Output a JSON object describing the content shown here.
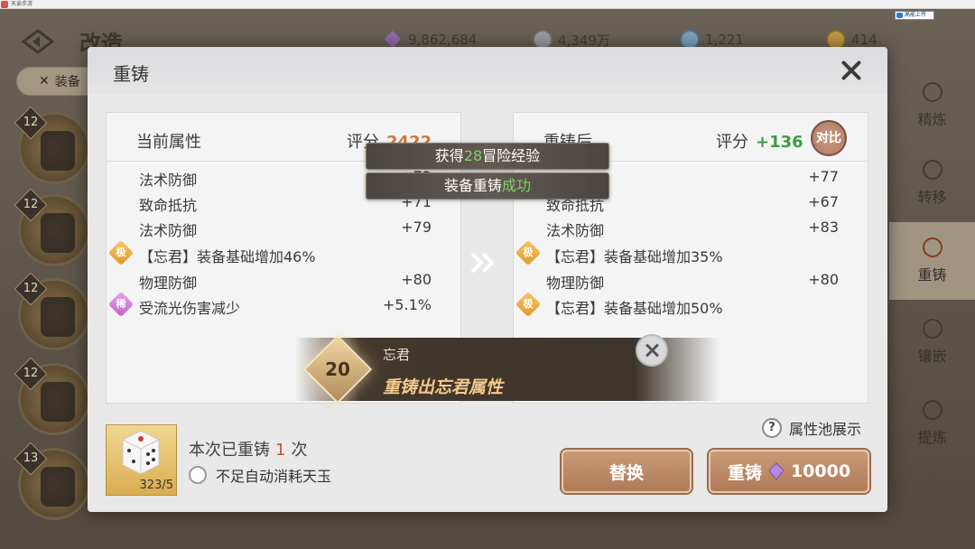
{
  "window": {
    "title": "天谕手游"
  },
  "header": {
    "page_title": "改造",
    "resources": [
      {
        "icon": "purple-crystal-icon",
        "value": "9,862,684"
      },
      {
        "icon": "silver-coin-icon",
        "value": "4,349万"
      },
      {
        "icon": "blue-gem-icon",
        "value": "1,221"
      },
      {
        "icon": "gold-coin-icon",
        "value": "414"
      }
    ],
    "upload_label": "高能上传"
  },
  "filter": {
    "label": "装备"
  },
  "slots": [
    {
      "level": "12"
    },
    {
      "level": "12"
    },
    {
      "level": "12"
    },
    {
      "level": "12"
    },
    {
      "level": "13"
    }
  ],
  "right_nav": [
    {
      "label": "精炼",
      "active": false
    },
    {
      "label": "转移",
      "active": false
    },
    {
      "label": "重铸",
      "active": true
    },
    {
      "label": "镶嵌",
      "active": false
    },
    {
      "label": "提炼",
      "active": false
    }
  ],
  "modal": {
    "title": "重铸",
    "current": {
      "title": "当前属性",
      "score_label": "评分",
      "score_value": "2422",
      "rows": [
        {
          "name": "法术防御",
          "value": "+72",
          "badge": ""
        },
        {
          "name": "致命抵抗",
          "value": "+71",
          "badge": ""
        },
        {
          "name": "法术防御",
          "value": "+79",
          "badge": ""
        },
        {
          "name": "【忘君】装备基础增加46%",
          "value": "",
          "badge": "极"
        },
        {
          "name": "物理防御",
          "value": "+80",
          "badge": ""
        },
        {
          "name": "受流光伤害减少",
          "value": "+5.1%",
          "badge": "稀"
        }
      ]
    },
    "after": {
      "title": "重铸后",
      "score_label": "评分",
      "score_value": "+136",
      "compare_label": "对比",
      "rows": [
        {
          "name": "法术防御",
          "value": "+77",
          "badge": ""
        },
        {
          "name": "致命抵抗",
          "value": "+67",
          "badge": ""
        },
        {
          "name": "法术防御",
          "value": "+83",
          "badge": ""
        },
        {
          "name": "【忘君】装备基础增加35%",
          "value": "",
          "badge": "极"
        },
        {
          "name": "物理防御",
          "value": "+80",
          "badge": ""
        },
        {
          "name": "【忘君】装备基础增加50%",
          "value": "",
          "badge": "极"
        }
      ]
    },
    "toasts": {
      "exp_prefix": "获得",
      "exp_value": "28",
      "exp_suffix": "冒险经验",
      "success_prefix": "装备重铸",
      "success_highlight": "成功"
    },
    "banner": {
      "level": "20",
      "name": "忘君",
      "text": "重铸出忘君属性"
    },
    "dice_count": "323/5",
    "reforge_count_prefix": "本次已重铸",
    "reforge_count_value": "1",
    "reforge_count_unit": "次",
    "auto_consume_label": "不足自动消耗天玉",
    "pool_label": "属性池展示",
    "replace_label": "替换",
    "reforge_label": "重铸",
    "reforge_cost": "10000"
  },
  "colors": {
    "score_current": "#d0783c",
    "score_after": "#3e9d3e",
    "button": "#b17a58",
    "badge_ji": "#e09a2a",
    "badge_xi": "#c061c8"
  }
}
